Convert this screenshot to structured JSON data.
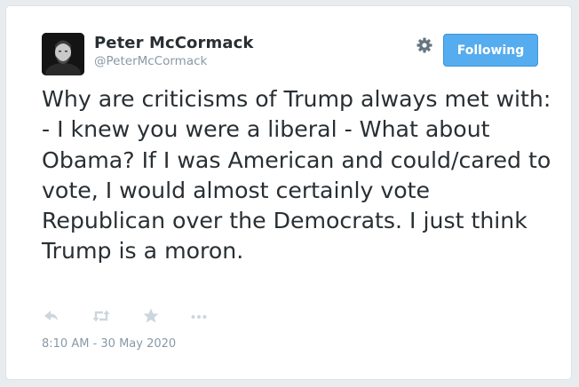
{
  "user": {
    "display_name": "Peter McCormack",
    "handle": "@PeterMcCormack"
  },
  "follow_button": {
    "label": "Following"
  },
  "tweet": {
    "text": "Why are criticisms of Trump always met with: - I knew you were a liberal - What about Obama? If I was American and could/cared to vote, I would almost certainly vote Republican over the Democrats. I just think Trump is a moron.",
    "timestamp": "8:10 AM - 30 May 2020"
  },
  "actions": [
    {
      "name": "reply-icon"
    },
    {
      "name": "retweet-icon"
    },
    {
      "name": "star-icon"
    },
    {
      "name": "more-icon"
    }
  ],
  "colors": {
    "accent": "#55acee",
    "text": "#292f33",
    "muted": "#8899a6",
    "icon": "#ccd6dd"
  }
}
